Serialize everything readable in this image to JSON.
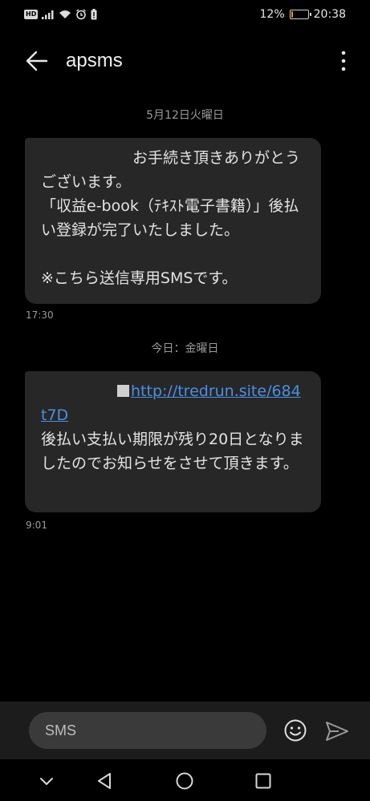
{
  "status_bar": {
    "hd_badge": "HD",
    "battery_percent": "12%",
    "battery_level": 0.12,
    "battery_color": "#f39800",
    "time": "20:38",
    "icons": [
      "signal-icon",
      "wifi-icon",
      "alarm-icon",
      "battery-alert-icon"
    ]
  },
  "header": {
    "title": "apsms",
    "back_icon": "arrow-left-icon",
    "more_icon": "more-vertical-icon"
  },
  "messages": [
    {
      "date_label": "5月12日火曜日",
      "body": "　　　　　　お手続き頂きありがとうございます。\n「収益e-book（ﾃｷｽﾄ電子書籍）」後払い登録が完了いたしました。\n\n※こちら送信専用SMSです。",
      "time": "17:30"
    },
    {
      "date_label": "今日：金曜日",
      "body_prefix": "　　　　　",
      "link_text": "http://tredrun.site/684t7D",
      "body_suffix": "\n後払い支払い期限が残り20日となりましたのでお知らせをさせて頂きます。",
      "time": "9:01"
    }
  ],
  "composer": {
    "placeholder": "SMS",
    "value": "",
    "emoji_icon": "emoji-icon",
    "send_icon": "send-icon"
  },
  "navbar": {
    "icons": [
      "collapse-chevron-icon",
      "back-triangle-icon",
      "home-circle-icon",
      "recents-square-icon"
    ]
  },
  "colors": {
    "background": "#000000",
    "bubble": "#272727",
    "link": "#4a90e2",
    "composer_bg": "#1c1c1c"
  }
}
